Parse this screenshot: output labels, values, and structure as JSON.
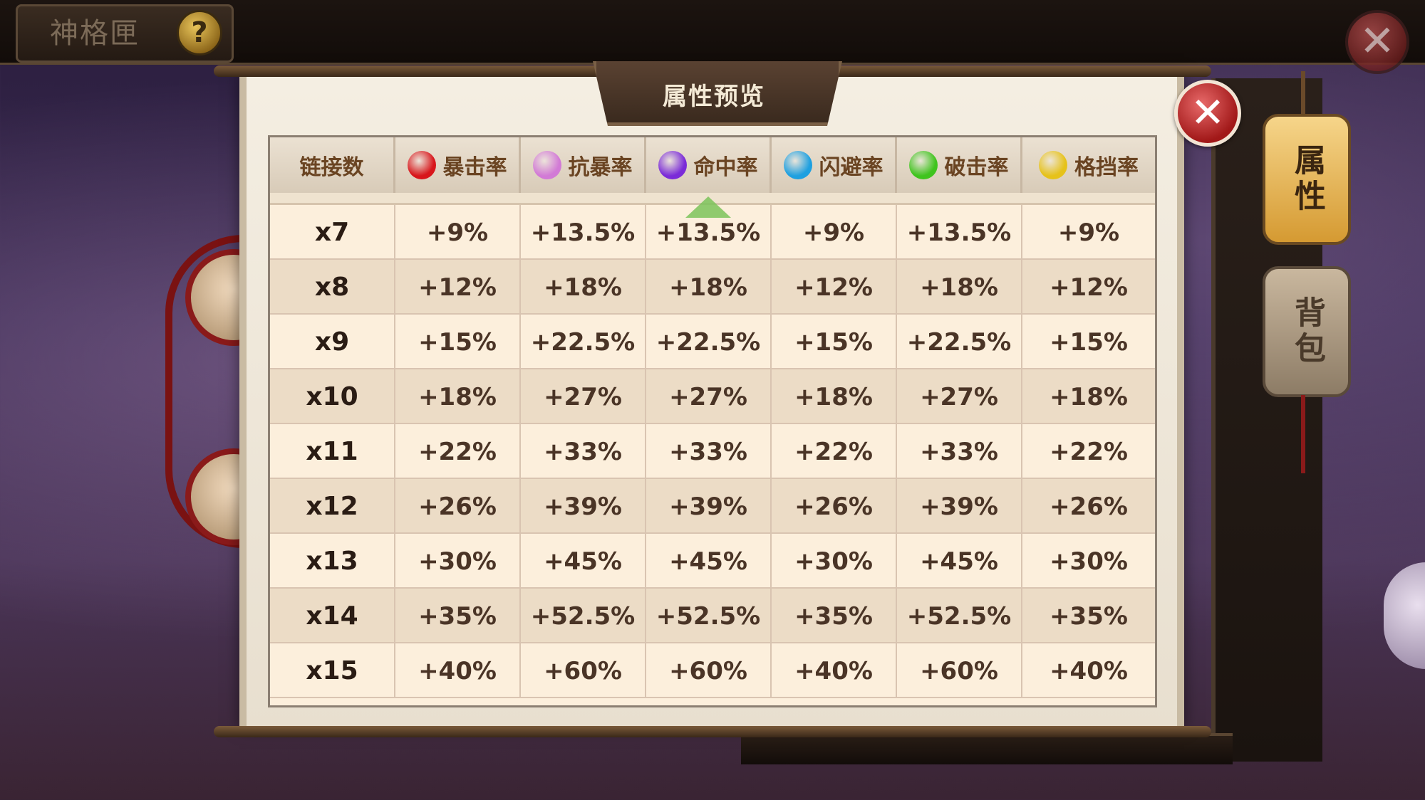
{
  "top_bar": {
    "title": "神格匣",
    "help_symbol": "?",
    "close_symbol": "✕"
  },
  "dialog": {
    "title": "属性预览",
    "close_symbol": "✕",
    "columns": [
      {
        "label": "链接数",
        "color": ""
      },
      {
        "label": "暴击率",
        "color": "#d8161b"
      },
      {
        "label": "抗暴率",
        "color": "#d27ad6"
      },
      {
        "label": "命中率",
        "color": "#7b2bd8"
      },
      {
        "label": "闪避率",
        "color": "#1ea0e0"
      },
      {
        "label": "破击率",
        "color": "#3fc41e"
      },
      {
        "label": "格挡率",
        "color": "#e6c21a"
      }
    ],
    "rows": [
      [
        "x7",
        "+9%",
        "+13.5%",
        "+13.5%",
        "+9%",
        "+13.5%",
        "+9%"
      ],
      [
        "x8",
        "+12%",
        "+18%",
        "+18%",
        "+12%",
        "+18%",
        "+12%"
      ],
      [
        "x9",
        "+15%",
        "+22.5%",
        "+22.5%",
        "+15%",
        "+22.5%",
        "+15%"
      ],
      [
        "x10",
        "+18%",
        "+27%",
        "+27%",
        "+18%",
        "+27%",
        "+18%"
      ],
      [
        "x11",
        "+22%",
        "+33%",
        "+33%",
        "+22%",
        "+33%",
        "+22%"
      ],
      [
        "x12",
        "+26%",
        "+39%",
        "+39%",
        "+26%",
        "+39%",
        "+26%"
      ],
      [
        "x13",
        "+30%",
        "+45%",
        "+45%",
        "+30%",
        "+45%",
        "+30%"
      ],
      [
        "x14",
        "+35%",
        "+52.5%",
        "+52.5%",
        "+35%",
        "+52.5%",
        "+35%"
      ],
      [
        "x15",
        "+40%",
        "+60%",
        "+60%",
        "+40%",
        "+60%",
        "+40%"
      ]
    ]
  },
  "side_tabs": [
    {
      "label": "属性"
    },
    {
      "label": "背包"
    }
  ]
}
